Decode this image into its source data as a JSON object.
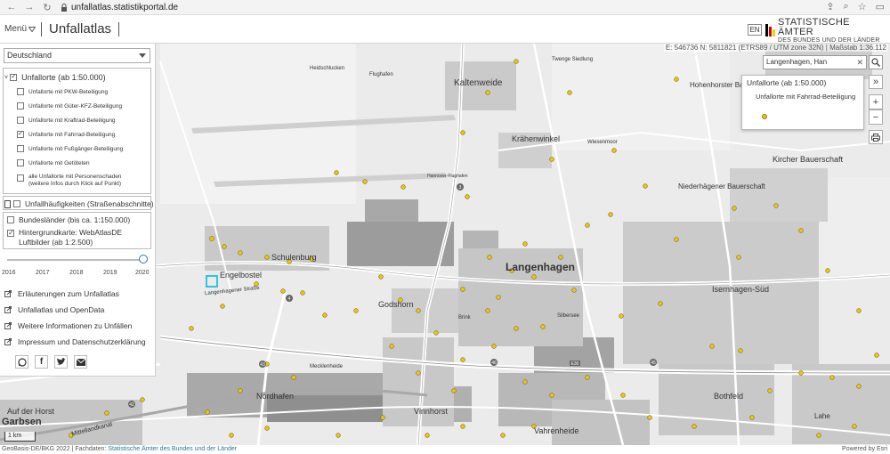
{
  "browser": {
    "url": "unfallatlas.statistikportal.de"
  },
  "header": {
    "menu_label": "Menü",
    "app_title": "Unfallatlas",
    "lang_button": "EN",
    "logo_line1": "STATISTISCHE ÄMTER",
    "logo_line2": "DES BUNDES UND DER LÄNDER",
    "logo_colors": [
      "#000000",
      "#dd0000",
      "#ffce00"
    ]
  },
  "map": {
    "coordinates": "E: 546736 N: 5811821 (ETRS89 / UTM zone 32N) | Maßstab 1:36.112",
    "accident_point_color": "#e6c320",
    "places": [
      {
        "label": "Langenhagen",
        "size": 12,
        "bold": true
      },
      {
        "label": "Kaltenweide",
        "size": 10
      },
      {
        "label": "Krähenwinkel",
        "size": 9
      },
      {
        "label": "Engelbostel",
        "size": 9
      },
      {
        "label": "Schulenburg",
        "size": 9
      },
      {
        "label": "Godshorn",
        "size": 9
      },
      {
        "label": "Isernhagen-Süd",
        "size": 9
      },
      {
        "label": "Bothfeld",
        "size": 9
      },
      {
        "label": "Vinnhorst",
        "size": 9
      },
      {
        "label": "Vahrenheide",
        "size": 9
      },
      {
        "label": "Nordhafen",
        "size": 9
      },
      {
        "label": "Kircher Bauerschaft",
        "size": 9
      },
      {
        "label": "Niederhägener Bauerschaft",
        "size": 8
      },
      {
        "label": "Hohenhorster Bauerschaft",
        "size": 8
      },
      {
        "label": "Lahe",
        "size": 8
      },
      {
        "label": "Auf der Horst",
        "size": 9
      },
      {
        "label": "Garbsen",
        "size": 11
      },
      {
        "label": "Langenhagener Straße",
        "size": 6
      },
      {
        "label": "Mittellandkanal",
        "size": 7
      },
      {
        "label": "Flughafen",
        "size": 6
      },
      {
        "label": "Twenge Siedlung",
        "size": 6
      },
      {
        "label": "Heidschlucken",
        "size": 6
      },
      {
        "label": "Wiesenmoor",
        "size": 6
      },
      {
        "label": "Hannover-Flughafen",
        "size": 5
      },
      {
        "label": "Mecklenheide",
        "size": 6
      },
      {
        "label": "Silbersee",
        "size": 6
      },
      {
        "label": "Brink",
        "size": 6
      }
    ]
  },
  "left_panel": {
    "region_select": "Deutschland",
    "unfallorte_title": "Unfallorte (ab 1:50.000)",
    "unfallorte_items": [
      {
        "label": "Unfallorte mit PKW-Beteiligung",
        "checked": false
      },
      {
        "label": "Unfallorte mit Güter-KFZ-Beteiligung",
        "checked": false
      },
      {
        "label": "Unfallorte mit Kraftrad-Beteiligung",
        "checked": false
      },
      {
        "label": "Unfallorte mit Fahrrad-Beteiligung",
        "checked": true
      },
      {
        "label": "Unfallorte mit Fußgänger-Beteiligung",
        "checked": false
      },
      {
        "label": "Unfallorte mit Getöteten",
        "checked": false
      }
    ],
    "personenschaden_line1": "alle Unfallorte mit Personenschaden",
    "personenschaden_line2": "(weitere Infos durch Klick auf Punkt)",
    "haeufigkeiten": "Unfallhäufigkeiten (Straßenabschnitte)",
    "bundeslaender": "Bundesländer (bis ca. 1:150.000)",
    "hintergrund_line1": "Hintergrundkarte: WebAtlasDE",
    "hintergrund_line2": "Luftbilder (ab 1:2.500)",
    "timeline_years": [
      "2016",
      "2017",
      "2018",
      "2019",
      "2020"
    ],
    "timeline_selected": "2020",
    "links": [
      "Erläuterungen zum Unfallatlas",
      "Unfallatlas und OpenData",
      "Weitere Informationen zu Unfällen",
      "Impressum und Datenschutzerklärung"
    ]
  },
  "search": {
    "value": "Langenhagen, Han"
  },
  "legend": {
    "title": "Unfallorte (ab 1:50.000)",
    "entry": "Unfallorte mit Fahrrad-Beteiligung"
  },
  "scalebar": "1 km",
  "footer": {
    "left": "GeoBasis-DE/BKG 2022 | Fachdaten: ",
    "link": "Statistische Ämter des Bundes und der Länder",
    "right": "Powered by Esri"
  }
}
